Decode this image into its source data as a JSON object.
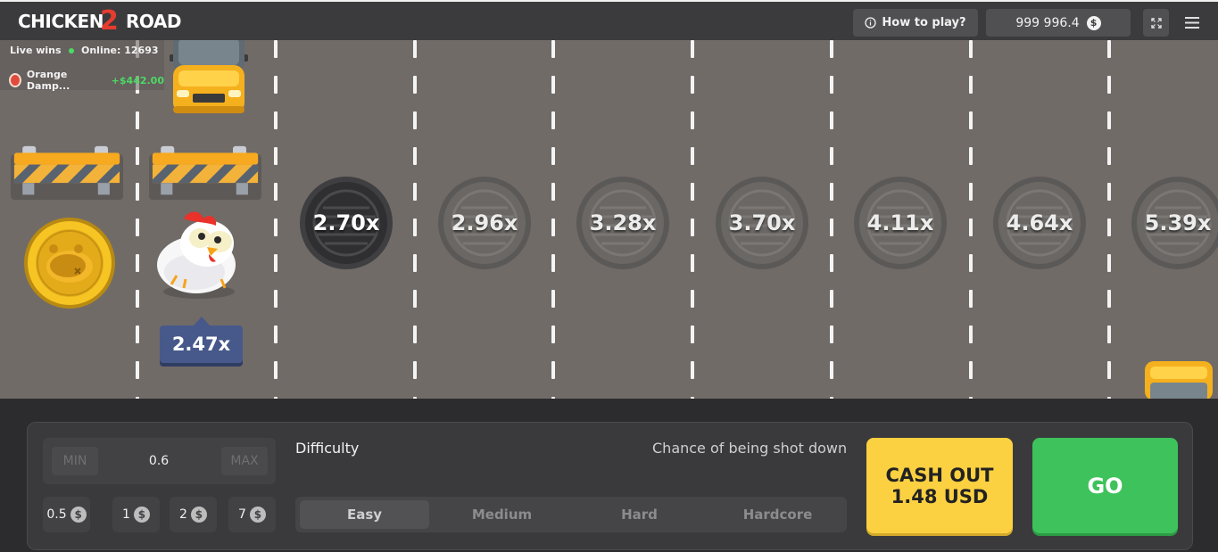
{
  "header": {
    "logo": "CHICKEN ROAD",
    "logo_word1": "CHICKEN",
    "logo_number": "2",
    "logo_word2": "ROAD",
    "how_to_play": "How to play?",
    "balance": "999 996.4",
    "currency_symbol": "$"
  },
  "live_wins": {
    "title": "Live wins",
    "online": "Online: 12693",
    "entry": {
      "user": "Orange Damp...",
      "amount": "+$442.00"
    }
  },
  "road": {
    "current_multiplier": "2.47x",
    "multipliers": [
      "2.70x",
      "2.96x",
      "3.28x",
      "3.70x",
      "4.11x",
      "4.64x",
      "5.39x"
    ]
  },
  "controls": {
    "bet": {
      "min_label": "MIN",
      "max_label": "MAX",
      "value": "0.6"
    },
    "chips": [
      "0.5",
      "1",
      "2",
      "7"
    ],
    "difficulty_label": "Difficulty",
    "chance_label": "Chance of being shot down",
    "difficulties": [
      "Easy",
      "Medium",
      "Hard",
      "Hardcore"
    ],
    "selected_difficulty": "Easy",
    "cash_out_line1": "CASH OUT",
    "cash_out_line2": "1.48 USD",
    "go_label": "GO"
  },
  "colors": {
    "road": "#716b68",
    "accent_yellow": "#fcd141",
    "accent_green": "#3ec25b",
    "tag_blue": "#47598a"
  }
}
